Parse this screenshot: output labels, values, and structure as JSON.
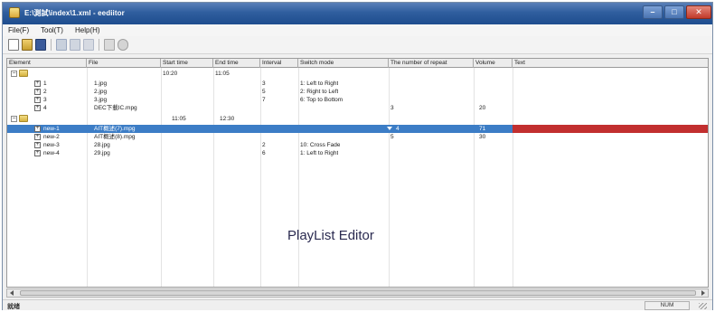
{
  "window": {
    "title": "E:\\測試\\index\\1.xml - eediitor"
  },
  "menu": [
    "File(F)",
    "Tool(T)",
    "Help(H)"
  ],
  "toolbar": {
    "buttons": [
      {
        "name": "new-file-icon",
        "color": "#ffffff"
      },
      {
        "name": "open-folder-icon",
        "color": "#d8b040"
      },
      {
        "name": "save-icon",
        "color": "#3a5a9a"
      },
      {
        "name": "add-icon",
        "color": "#9aa8c0"
      },
      {
        "name": "insert-icon",
        "color": "#b0b8c8"
      },
      {
        "name": "copy-icon",
        "color": "#b8c0cc"
      },
      {
        "name": "delete-icon",
        "color": "#b0b0b0"
      },
      {
        "name": "settings-icon",
        "color": "#a8a8a8"
      }
    ]
  },
  "columns": [
    "Element",
    "File",
    "Start time",
    "End time",
    "Interval",
    "Switch mode",
    "The number of repeat",
    "Volume",
    "Text"
  ],
  "rows": [
    {
      "type": "group",
      "start": "10:20",
      "end": "11:05"
    },
    {
      "type": "item",
      "element": "1",
      "file": "1.jpg",
      "interval": "3",
      "switch": "1: Left to Right"
    },
    {
      "type": "item",
      "element": "2",
      "file": "2.jpg",
      "interval": "5",
      "switch": "2: Right to Left"
    },
    {
      "type": "item",
      "element": "3",
      "file": "3.jpg",
      "interval": "7",
      "switch": "6: Top to Bottom"
    },
    {
      "type": "item",
      "element": "4",
      "file": "DEC下載IC.mpg",
      "repeat": "3",
      "volume": "20"
    },
    {
      "type": "group",
      "start": "11:05",
      "end": "12:30"
    },
    {
      "type": "item",
      "element": "new-1",
      "file": "AIT概述(7).mpg",
      "repeat": "4",
      "volume": "71",
      "selected": true
    },
    {
      "type": "item",
      "element": "new-2",
      "file": "AIT概述(8).mpg",
      "repeat": "5",
      "volume": "30"
    },
    {
      "type": "item",
      "element": "new-3",
      "file": "28.jpg",
      "interval": "2",
      "switch": "10: Cross Fade"
    },
    {
      "type": "item",
      "element": "new-4",
      "file": "29.jpg",
      "interval": "6",
      "switch": "1: Left to Right"
    }
  ],
  "watermark": "PlayList Editor",
  "status": {
    "left": "就绪",
    "panel": "NUM"
  }
}
